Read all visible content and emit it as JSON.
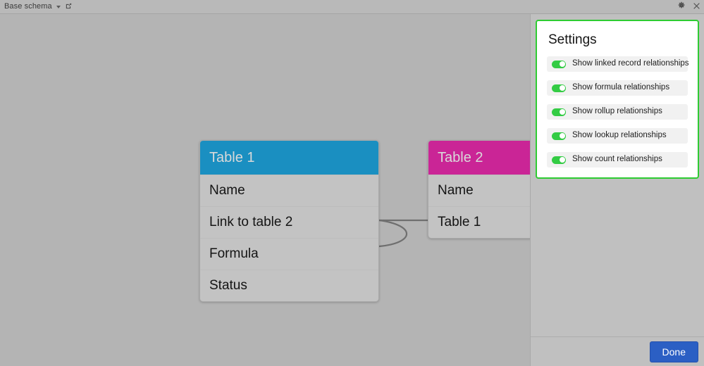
{
  "titlebar": {
    "title": "Base schema",
    "dropdown_icon": "caret-down-icon",
    "external_link_icon": "external-link-icon",
    "gear_icon": "gear-icon",
    "close_icon": "close-icon"
  },
  "canvas": {
    "tables": [
      {
        "name": "Table 1",
        "header_color": "#1a8fc1",
        "fields": [
          "Name",
          "Link to table 2",
          "Formula",
          "Status"
        ]
      },
      {
        "name": "Table 2",
        "header_color": "#ca2596",
        "fields": [
          "Name",
          "Table 1"
        ]
      }
    ]
  },
  "settings": {
    "title": "Settings",
    "border_color": "#2ecc32",
    "toggle_on_color": "#33cc44",
    "rows": [
      {
        "label": "Show linked record relationships",
        "enabled": true
      },
      {
        "label": "Show formula relationships",
        "enabled": true
      },
      {
        "label": "Show rollup relationships",
        "enabled": true
      },
      {
        "label": "Show lookup relationships",
        "enabled": true
      },
      {
        "label": "Show count relationships",
        "enabled": true
      }
    ]
  },
  "footer": {
    "done_label": "Done",
    "done_color": "#2b5fc4"
  }
}
